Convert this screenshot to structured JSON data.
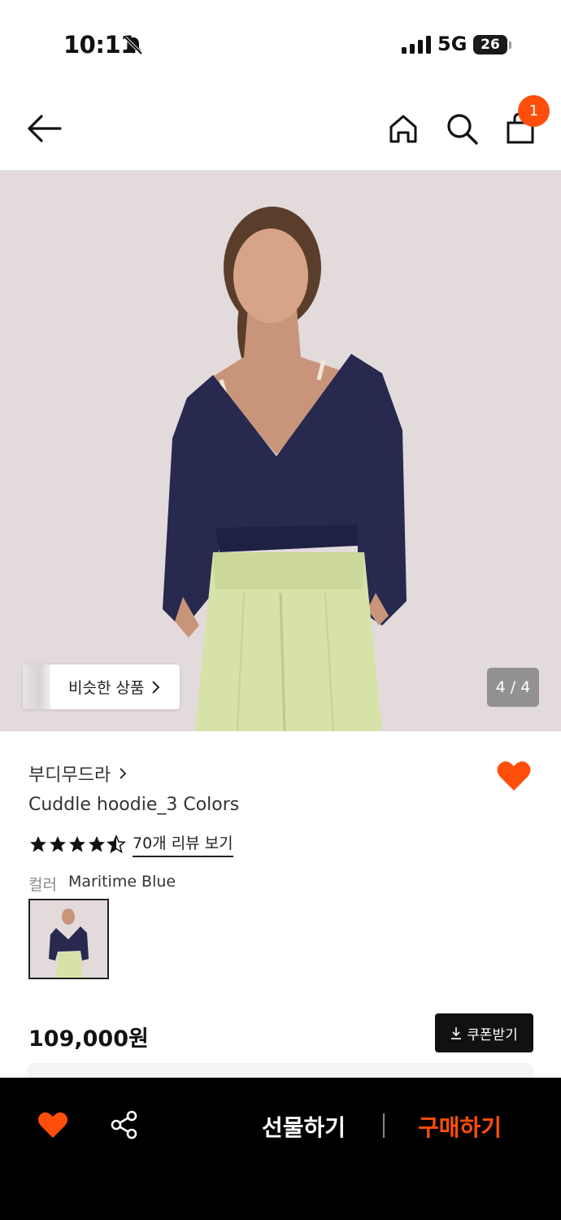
{
  "status_bar": {
    "time": "10:11",
    "network": "5G",
    "battery": "26"
  },
  "header": {
    "cart_count": "1"
  },
  "hero": {
    "similar_label": "비슷한 상품",
    "page_indicator": "4 / 4"
  },
  "product": {
    "brand": "부디무드라",
    "title": "Cuddle hoodie_3 Colors",
    "rating": 4.5,
    "review_link": "70개 리뷰 보기",
    "color_label": "컬러",
    "color_value": "Maritime Blue",
    "price": "109,000원",
    "coupon_label": "쿠폰받기"
  },
  "bottom_bar": {
    "gift_label": "선물하기",
    "buy_label": "구매하기"
  },
  "colors": {
    "accent": "#ff4e0b",
    "dark": "#111111",
    "hero_bg": "#e3dadc",
    "hoodie": "#27294f",
    "pants": "#d7e2a8"
  },
  "icons": [
    "bell-off-icon",
    "signal-icon",
    "back-arrow-icon",
    "home-icon",
    "search-icon",
    "shopping-bag-icon",
    "chevron-right-icon",
    "heart-icon",
    "star-icon",
    "download-icon",
    "share-icon"
  ]
}
